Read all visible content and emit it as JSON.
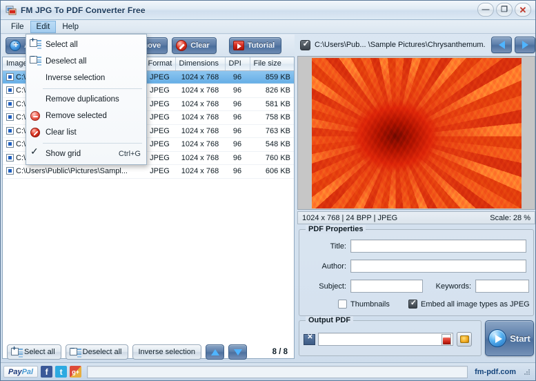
{
  "window": {
    "title": "FM JPG To PDF Converter Free",
    "app_icon": "app-icon",
    "controls": {
      "minimize": "–",
      "maximize": "❐",
      "close": "✕"
    }
  },
  "menubar": {
    "items": [
      {
        "label": "File",
        "active": false
      },
      {
        "label": "Edit",
        "active": true
      },
      {
        "label": "Help",
        "active": false
      }
    ]
  },
  "edit_menu": {
    "items": [
      {
        "label": "Select all",
        "icon": "select-all-icon",
        "shortcut": ""
      },
      {
        "label": "Deselect all",
        "icon": "deselect-all-icon",
        "shortcut": ""
      },
      {
        "label": "Inverse selection",
        "icon": "",
        "shortcut": ""
      },
      {
        "label": "Remove duplications",
        "icon": "",
        "shortcut": ""
      },
      {
        "label": "Remove selected",
        "icon": "remove-selected-icon",
        "shortcut": ""
      },
      {
        "label": "Clear list",
        "icon": "clear-list-icon",
        "shortcut": ""
      },
      {
        "label": "Show grid",
        "icon": "checkmark-icon",
        "shortcut": "Ctrl+G"
      }
    ]
  },
  "toolbar": {
    "add_label": "Add",
    "remove_label": "Remove",
    "clear_label": "Clear",
    "tutorial_label": "Tutorial"
  },
  "filelist": {
    "columns": [
      "Image",
      "Format",
      "Dimensions",
      "DPI",
      "File size"
    ],
    "rows": [
      {
        "checked": true,
        "image": "C:\\Users\\Public\\Pictures\\Sampl...",
        "format": "JPEG",
        "dimensions": "1024 x 768",
        "dpi": "96",
        "filesize": "859 KB",
        "selected": true
      },
      {
        "checked": true,
        "image": "C:\\Users\\Public\\Pictures\\Sampl...",
        "format": "JPEG",
        "dimensions": "1024 x 768",
        "dpi": "96",
        "filesize": "826 KB",
        "selected": false
      },
      {
        "checked": true,
        "image": "C:\\Users\\Public\\Pictures\\Sampl...",
        "format": "JPEG",
        "dimensions": "1024 x 768",
        "dpi": "96",
        "filesize": "581 KB",
        "selected": false
      },
      {
        "checked": true,
        "image": "C:\\Users\\Public\\Pictures\\Sampl...",
        "format": "JPEG",
        "dimensions": "1024 x 768",
        "dpi": "96",
        "filesize": "758 KB",
        "selected": false
      },
      {
        "checked": true,
        "image": "C:\\Users\\Public\\Pictures\\Sampl...",
        "format": "JPEG",
        "dimensions": "1024 x 768",
        "dpi": "96",
        "filesize": "763 KB",
        "selected": false
      },
      {
        "checked": true,
        "image": "C:\\Users\\Public\\Pictures\\Sampl...",
        "format": "JPEG",
        "dimensions": "1024 x 768",
        "dpi": "96",
        "filesize": "548 KB",
        "selected": false
      },
      {
        "checked": true,
        "image": "C:\\Users\\Public\\Pictures\\Sampl...",
        "format": "JPEG",
        "dimensions": "1024 x 768",
        "dpi": "96",
        "filesize": "760 KB",
        "selected": false
      },
      {
        "checked": true,
        "image": "C:\\Users\\Public\\Pictures\\Sampl...",
        "format": "JPEG",
        "dimensions": "1024 x 768",
        "dpi": "96",
        "filesize": "606 KB",
        "selected": false
      }
    ]
  },
  "preview": {
    "checked": true,
    "path": "C:\\Users\\Pub... \\Sample Pictures\\Chrysanthemum.",
    "prev_icon": "arrow-left-icon",
    "next_icon": "arrow-right-icon",
    "info": "1024 x 768 | 24 BPP | JPEG",
    "scale": "Scale: 28 %"
  },
  "pdf_properties": {
    "title": "PDF Properties",
    "fields": {
      "title_label": "Title:",
      "title_value": "",
      "author_label": "Author:",
      "author_value": "",
      "subject_label": "Subject:",
      "subject_value": "",
      "keywords_label": "Keywords:",
      "keywords_value": ""
    },
    "thumbnails_label": "Thumbnails",
    "thumbnails_checked": false,
    "embed_label": "Embed all image types as JPEG",
    "embed_checked": true
  },
  "output_pdf": {
    "title": "Output PDF",
    "path_value": "",
    "path_placeholder": "",
    "pdf_icon": "pdf-file-icon",
    "browse_icon": "folder-icon",
    "clear_icon": "clear-path-icon"
  },
  "start_button": {
    "label": "Start",
    "icon": "play-icon"
  },
  "bottombar": {
    "select_all": "Select all",
    "deselect_all": "Deselect all",
    "inverse_selection": "Inverse selection",
    "move_up_icon": "arrow-up-icon",
    "move_down_icon": "arrow-down-icon",
    "counter": "8 / 8"
  },
  "statusbar": {
    "paypal_part1": "Pay",
    "paypal_part2": "Pal",
    "facebook": "f",
    "twitter": "t",
    "googleplus": "g+",
    "status_text": "",
    "brand": "fm-pdf.com"
  },
  "colors": {
    "accent_blue": "#4d719f",
    "selection_blue": "#66aee6",
    "title_text": "#1d3b5c",
    "red": "#cf2618",
    "brand": "#14447c"
  }
}
